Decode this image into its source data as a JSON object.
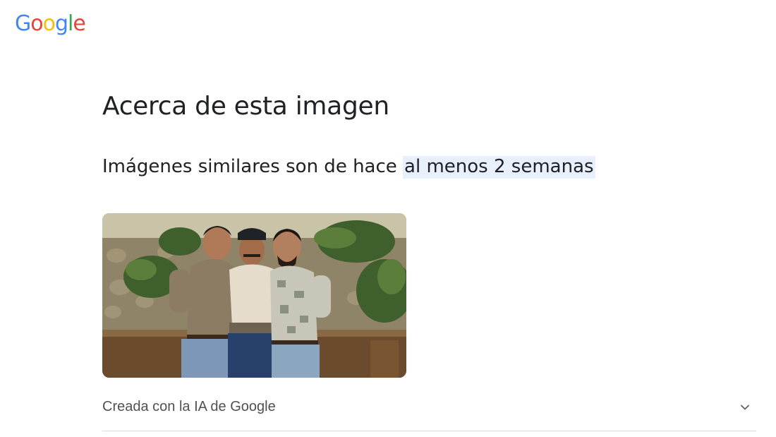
{
  "logo": {
    "letters": [
      "G",
      "o",
      "o",
      "g",
      "l",
      "e"
    ],
    "colors": [
      "#4285F4",
      "#EA4335",
      "#FBBC05",
      "#4285F4",
      "#34A853",
      "#EA4335"
    ]
  },
  "page": {
    "title": "Acerca de esta imagen",
    "subtitle_prefix": "Imágenes similares son de hace ",
    "subtitle_highlight": "al menos 2 semanas",
    "highlight_color": "#e8f0fe"
  },
  "image": {
    "icon": "photo-three-men-outdoors"
  },
  "ai_section": {
    "label": "Creada con la IA de Google",
    "icon": "chevron-down-icon",
    "expanded": false
  }
}
